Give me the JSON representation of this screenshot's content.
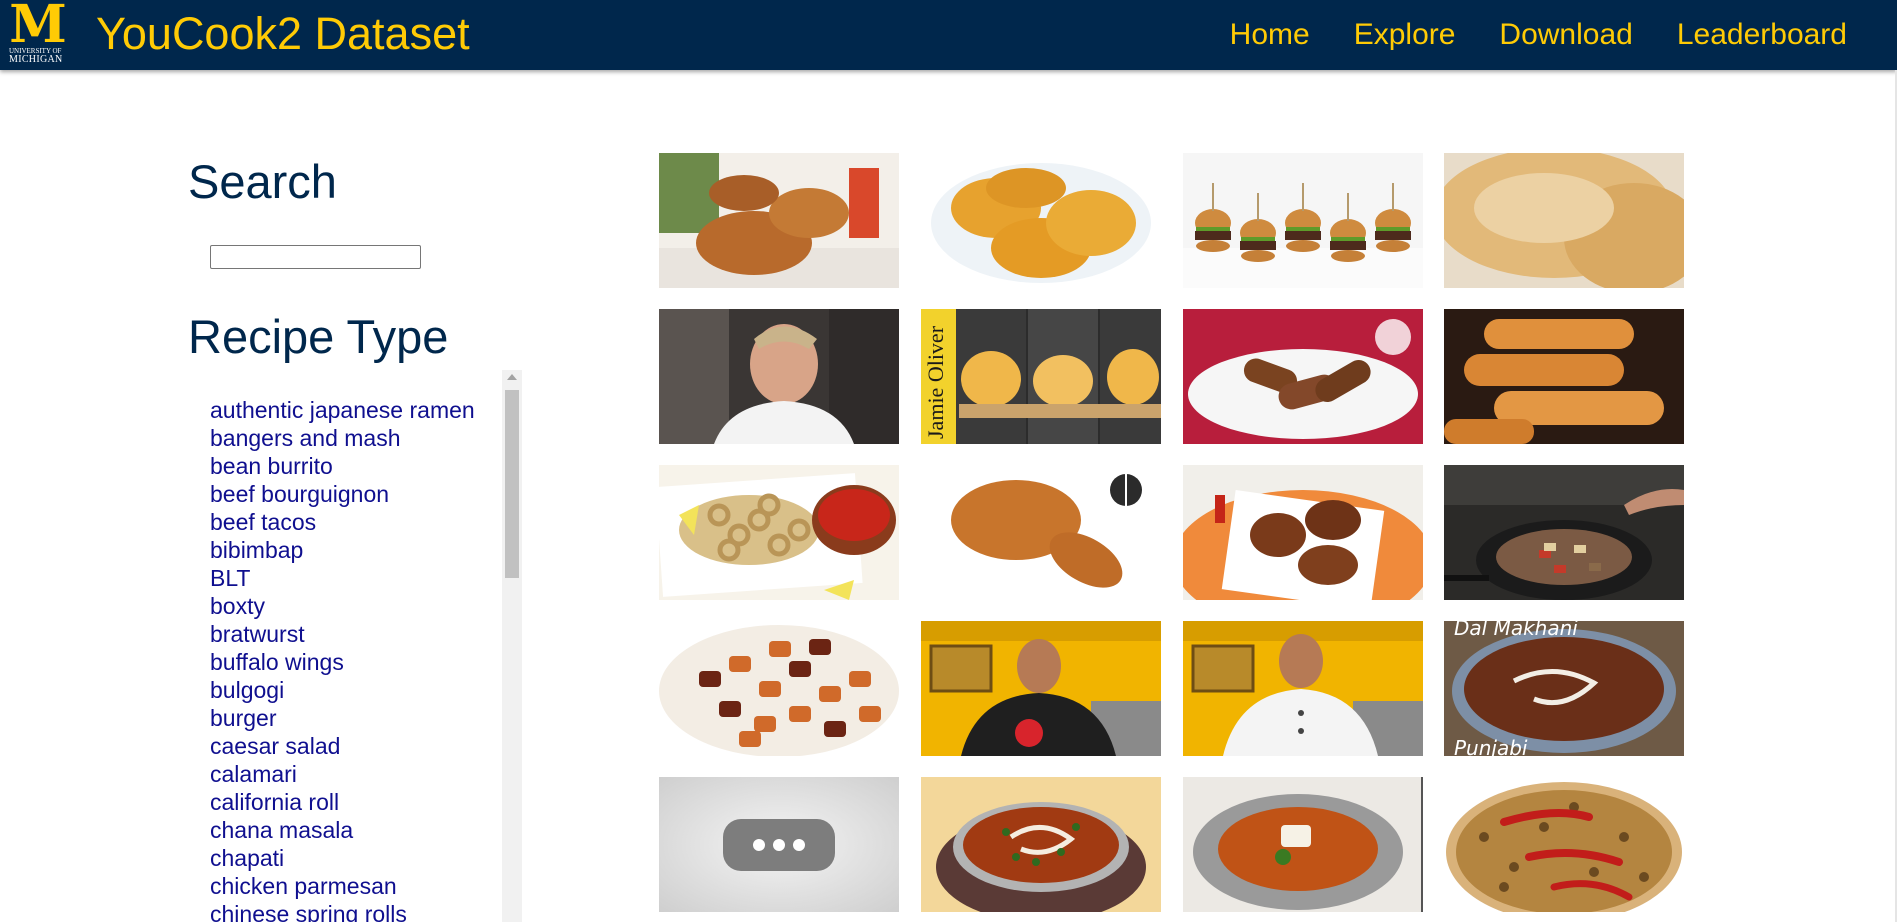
{
  "header": {
    "logo_letter": "M",
    "logo_sub1": "UNIVERSITY OF",
    "logo_sub2": "MICHIGAN",
    "title": "YouCook2 Dataset",
    "nav": [
      "Home",
      "Explore",
      "Download",
      "Leaderboard"
    ]
  },
  "sidebar": {
    "search_heading": "Search",
    "search_value": "",
    "recipe_heading": "Recipe Type",
    "recipe_types": [
      "authentic japanese ramen",
      "bangers and mash",
      "bean burrito",
      "beef bourguignon",
      "beef tacos",
      "bibimbap",
      "BLT",
      "boxty",
      "bratwurst",
      "buffalo wings",
      "bulgogi",
      "burger",
      "caesar salad",
      "calamari",
      "california roll",
      "chana masala",
      "chapati",
      "chicken parmesan",
      "chinese spring rolls"
    ]
  },
  "thumbnails": [
    {
      "name": "fried-chicken-plate",
      "overlay": ""
    },
    {
      "name": "hash-brown-patties",
      "overlay": ""
    },
    {
      "name": "slider-burgers",
      "overlay": ""
    },
    {
      "name": "hash-brown-closeup",
      "overlay": ""
    },
    {
      "name": "chef-cooking",
      "overlay": ""
    },
    {
      "name": "scrambled-egg-toast",
      "overlay": "Jamie Oliver"
    },
    {
      "name": "corn-dogs-plate",
      "overlay": ""
    },
    {
      "name": "corn-dogs-board",
      "overlay": ""
    },
    {
      "name": "fried-calamari",
      "overlay": ""
    },
    {
      "name": "fried-drumstick",
      "overlay": ""
    },
    {
      "name": "fried-chicken-orange-plate",
      "overlay": ""
    },
    {
      "name": "wok-stir-fry",
      "overlay": ""
    },
    {
      "name": "kung-pao-chicken",
      "overlay": ""
    },
    {
      "name": "chef-black-jacket",
      "overlay": ""
    },
    {
      "name": "chef-white-jacket",
      "overlay": ""
    },
    {
      "name": "dal-makhani",
      "overlay": "Dal Makhani",
      "overlay2": "Punjabi"
    },
    {
      "name": "video-unavailable",
      "overlay": ""
    },
    {
      "name": "curry-pot",
      "overlay": ""
    },
    {
      "name": "curry-bowl",
      "overlay": ""
    },
    {
      "name": "dal-with-chilies",
      "overlay": ""
    }
  ],
  "colors": {
    "navbar": "#00274c",
    "maize": "#ffcb05",
    "heading": "#00274c",
    "link": "#0f0f8f"
  }
}
